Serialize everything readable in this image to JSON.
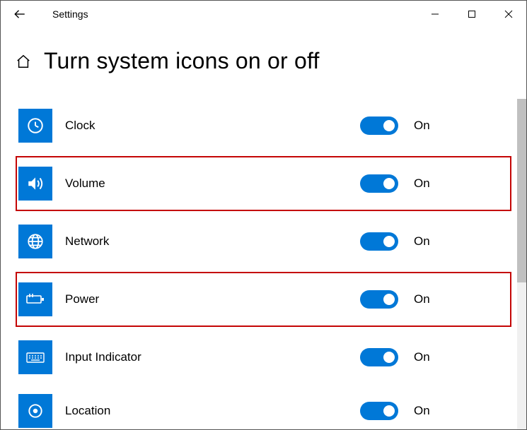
{
  "window": {
    "title": "Settings"
  },
  "page": {
    "heading": "Turn system icons on or off"
  },
  "state_labels": {
    "on": "On"
  },
  "items": [
    {
      "label": "Clock",
      "state": "On",
      "highlight": false,
      "icon": "clock"
    },
    {
      "label": "Volume",
      "state": "On",
      "highlight": true,
      "icon": "volume"
    },
    {
      "label": "Network",
      "state": "On",
      "highlight": false,
      "icon": "network"
    },
    {
      "label": "Power",
      "state": "On",
      "highlight": true,
      "icon": "power"
    },
    {
      "label": "Input Indicator",
      "state": "On",
      "highlight": false,
      "icon": "keyboard"
    },
    {
      "label": "Location",
      "state": "On",
      "highlight": false,
      "icon": "location"
    }
  ]
}
